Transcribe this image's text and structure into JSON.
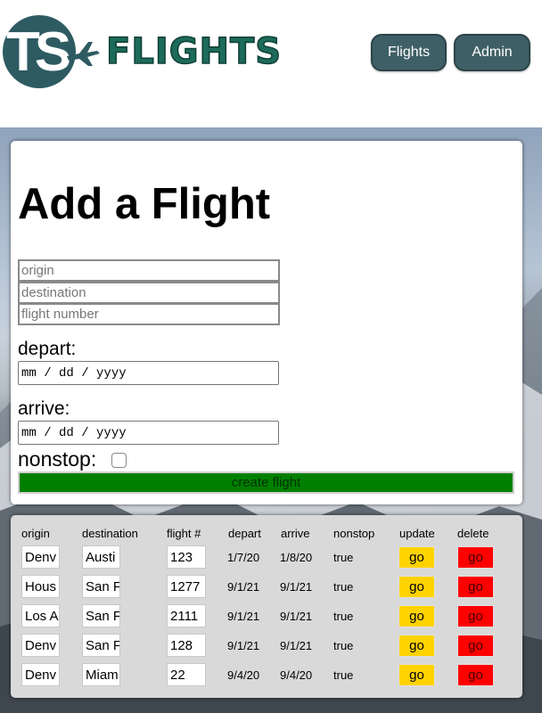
{
  "header": {
    "logo_mark": "TS",
    "logo_text": "FLIGHTS",
    "nav": [
      {
        "label": "Flights"
      },
      {
        "label": "Admin"
      }
    ]
  },
  "form": {
    "title": "Add a Flight",
    "origin_placeholder": "origin",
    "destination_placeholder": "destination",
    "flight_number_placeholder": "flight number",
    "depart_label": "depart:",
    "depart_placeholder": "mm / dd / yyyy",
    "arrive_label": "arrive:",
    "arrive_placeholder": "mm / dd / yyyy",
    "nonstop_label": "nonstop:",
    "nonstop_checked": false,
    "create_button": "create flight"
  },
  "table": {
    "headers": [
      "origin",
      "destination",
      "flight #",
      "depart",
      "arrive",
      "nonstop",
      "update",
      "delete"
    ],
    "update_button": "go",
    "delete_button": "go",
    "rows": [
      {
        "origin": "Denv",
        "destination": "Austi",
        "flight": "123",
        "depart": "1/7/20",
        "arrive": "1/8/20",
        "nonstop": "true"
      },
      {
        "origin": "Hous",
        "destination": "San F",
        "flight": "1277",
        "depart": "9/1/21",
        "arrive": "9/1/21",
        "nonstop": "true"
      },
      {
        "origin": "Los A",
        "destination": "San F",
        "flight": "2111",
        "depart": "9/1/21",
        "arrive": "9/1/21",
        "nonstop": "true"
      },
      {
        "origin": "Denv",
        "destination": "San F",
        "flight": "128",
        "depart": "9/1/21",
        "arrive": "9/1/21",
        "nonstop": "true"
      },
      {
        "origin": "Denv",
        "destination": "Miam",
        "flight": "22",
        "depart": "9/4/20",
        "arrive": "9/4/20",
        "nonstop": "true"
      }
    ]
  },
  "colors": {
    "nav_button": "#3f5f66",
    "logo_primary": "#2e5b62",
    "logo_text": "#1d6b5a",
    "create_button": "#008000",
    "update_button": "#ffd300",
    "delete_button": "#ff0000"
  },
  "icons": {
    "logo_plane": "airplane-icon"
  }
}
